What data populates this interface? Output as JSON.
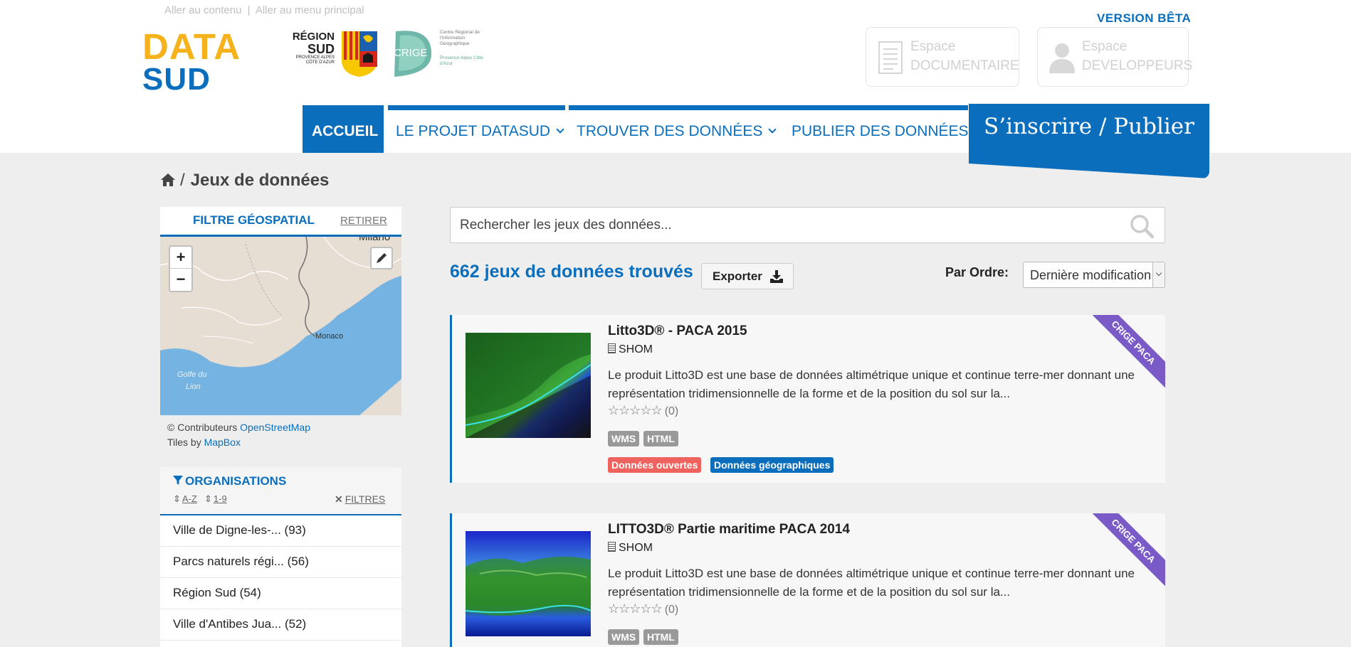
{
  "header": {
    "skip_links": [
      "Aller au contenu",
      "Aller au menu principal"
    ],
    "skip_separator": "|",
    "beta": "VERSION BÊTA",
    "logo": {
      "line1": "DATA",
      "line2": "SUD"
    },
    "region_logo": {
      "line1": "RÉGION",
      "line2": "SUD",
      "small": "PROVENCE ALPES CÔTE D'AZUR"
    },
    "crige_logo": {
      "name": "CRIGE",
      "caption1": "Centre Régional de l'Information Géographique",
      "caption2": "Provence Alpes Côte d'Azur"
    },
    "spaces": [
      {
        "line1": "Espace",
        "line2": "DOCUMENTAIRE",
        "icon": "document-icon"
      },
      {
        "line1": "Espace",
        "line2": "DEVELOPPEURS",
        "icon": "user-icon"
      }
    ]
  },
  "nav": {
    "items": [
      {
        "label": "ACCUEIL",
        "active": true
      },
      {
        "label": "LE PROJET DATASUD",
        "dropdown": true
      },
      {
        "label": "TROUVER DES DONNÉES",
        "dropdown": true
      },
      {
        "label": "PUBLIER DES DONNÉES"
      }
    ],
    "cta": "S’inscrire / Publier"
  },
  "breadcrumb": {
    "separator": "/",
    "current": "Jeux de données"
  },
  "geo_filter": {
    "title": "FILTRE GÉOSPATIAL",
    "remove": "RETIRER",
    "zoom_in": "+",
    "zoom_out": "−",
    "labels": {
      "milano": "Milano",
      "monaco": "Monaco",
      "golfe1": "Golfe du",
      "golfe2": "Lion"
    },
    "credits_prefix": "© Contributeurs",
    "credits_link": "OpenStreetMap",
    "tiles_prefix": "Tiles by",
    "tiles_link": "MapBox"
  },
  "organisations": {
    "title": "ORGANISATIONS",
    "sort_az": "A-Z",
    "sort_19": "1-9",
    "filters": "FILTRES",
    "items": [
      "Ville de Digne-les-... (93)",
      "Parcs naturels régi... (56)",
      "Région Sud (54)",
      "Ville d'Antibes Jua... (52)"
    ]
  },
  "search": {
    "placeholder": "Rechercher les jeux des données..."
  },
  "results": {
    "count": "662 jeux de données trouvés",
    "export": "Exporter",
    "order_label": "Par Ordre:",
    "order_value": "Dernière modification"
  },
  "datasets": [
    {
      "title": "Litto3D® - PACA 2015",
      "org": "SHOM",
      "desc": "Le produit Litto3D est une base de données altimétrique unique et continue terre-mer donnant une représentation tridimensionnelle de la forme et de la position du sol sur la...",
      "stars": "☆☆☆☆☆",
      "rating_count": "(0)",
      "formats": [
        "WMS",
        "HTML"
      ],
      "tags": [
        "Données ouvertes",
        "Données géographiques"
      ],
      "ribbon": "CRIGE PACA"
    },
    {
      "title": "LITTO3D® Partie maritime PACA 2014",
      "org": "SHOM",
      "desc": "Le produit Litto3D est une base de données altimétrique unique et continue terre-mer donnant une représentation tridimensionnelle de la forme et de la position du sol sur la...",
      "stars": "☆☆☆☆☆",
      "rating_count": "(0)",
      "formats": [
        "WMS",
        "HTML"
      ],
      "ribbon": "CRIGE PACA"
    }
  ],
  "colors": {
    "primary": "#0a6ebd",
    "accent_yellow": "#f5b21a",
    "tag_open": "#f0625e",
    "tag_format": "#999999",
    "ribbon": "#7a5ac6"
  }
}
